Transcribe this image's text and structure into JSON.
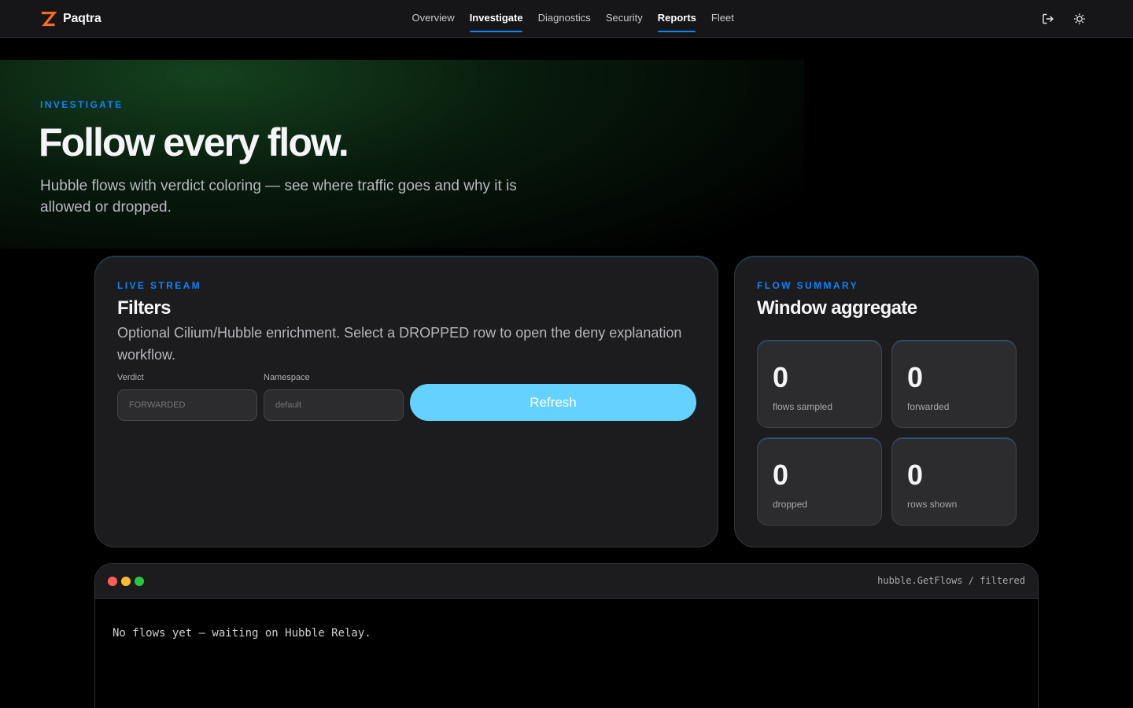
{
  "app": {
    "name": "Paqtra",
    "logo_color": "#ff6a2b"
  },
  "nav": {
    "items": [
      {
        "label": "Overview",
        "bold": false,
        "underlined": false
      },
      {
        "label": "Investigate",
        "bold": true,
        "underlined": true
      },
      {
        "label": "Diagnostics",
        "bold": false,
        "underlined": false
      },
      {
        "label": "Security",
        "bold": false,
        "underlined": false
      },
      {
        "label": "Reports",
        "bold": true,
        "underlined": true
      },
      {
        "label": "Fleet",
        "bold": false,
        "underlined": false
      }
    ],
    "icons": [
      "logout-icon",
      "theme-toggle-sun-icon"
    ]
  },
  "hero": {
    "eyebrow": "INVESTIGATE",
    "title": "Follow every flow.",
    "subtitle": "Hubble flows with verdict coloring — see where traffic goes and why it is allowed or dropped."
  },
  "filters": {
    "eyebrow": "LIVE STREAM",
    "title": "Filters",
    "description": "Optional Cilium/Hubble enrichment. Select a DROPPED row to open the deny explanation workflow.",
    "verdict": {
      "label": "Verdict",
      "placeholder": "FORWARDED",
      "value": ""
    },
    "namespace": {
      "label": "Namespace",
      "placeholder": "default",
      "value": ""
    },
    "refresh_label": "Refresh"
  },
  "summary": {
    "eyebrow": "FLOW SUMMARY",
    "title": "Window aggregate",
    "stats": [
      {
        "value": "0",
        "label": "flows sampled"
      },
      {
        "value": "0",
        "label": "forwarded"
      },
      {
        "value": "0",
        "label": "dropped"
      },
      {
        "value": "0",
        "label": "rows shown"
      }
    ]
  },
  "terminal": {
    "title": "hubble.GetFlows / filtered",
    "empty_message": "No flows yet — waiting on Hubble Relay."
  },
  "colors": {
    "accent": "#0a84ff",
    "button": "#64d2ff",
    "card_bg": "#1c1c1e",
    "page_bg": "#000000",
    "hero_glow": "#1a5226"
  }
}
